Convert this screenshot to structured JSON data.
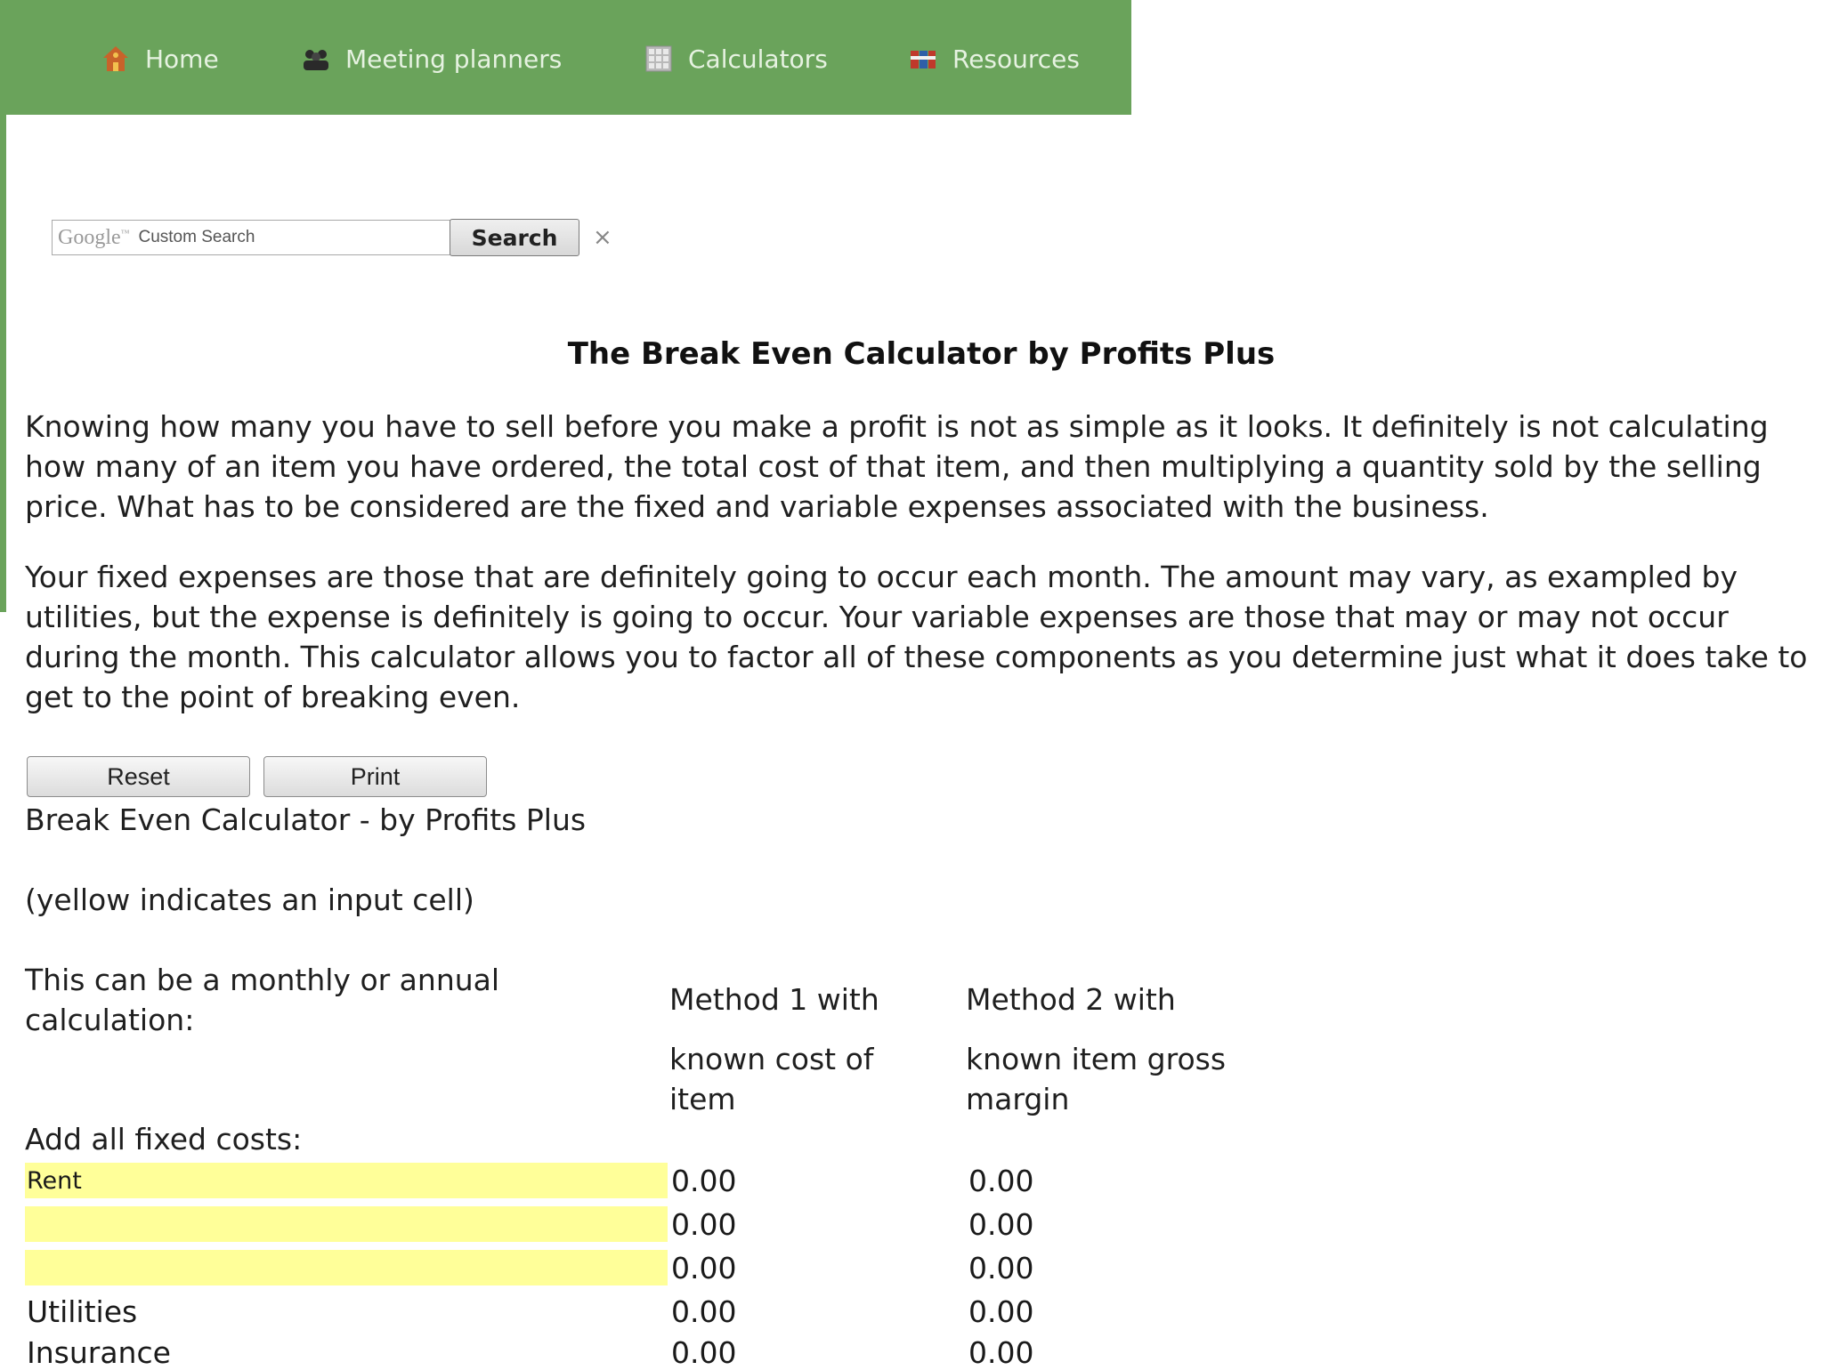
{
  "nav": {
    "items": [
      {
        "label": "Home",
        "icon": "home-icon"
      },
      {
        "label": "Meeting planners",
        "icon": "people-icon"
      },
      {
        "label": "Calculators",
        "icon": "calculator-icon"
      },
      {
        "label": "Resources",
        "icon": "books-icon"
      }
    ]
  },
  "search": {
    "logo_text": "Google",
    "logo_tm": "™",
    "placeholder": "Custom Search",
    "button_label": "Search",
    "clear": "×"
  },
  "page": {
    "title": "The Break Even Calculator by Profits Plus",
    "intro": [
      "Knowing how many you have to sell before you make a profit is not as simple as it looks. It definitely is not calculating how many of an item you have ordered, the total cost of that item, and then multiplying a quantity sold by the selling price. What has to be considered are the fixed and variable expenses associated with the business.",
      "Your fixed expenses are those that are definitely going to occur each month. The amount may vary, as exampled by utilities, but the expense is definitely is going to occur. Your variable expenses are those that may or may not occur during the month. This calculator allows you to factor all of these components as you determine just what it does take to get to the point of breaking even."
    ]
  },
  "calculator": {
    "reset_label": "Reset",
    "print_label": "Print",
    "title": "Break Even Calculator - by Profits Plus",
    "input_note": "(yellow indicates an input cell)",
    "period_note": "This can be a monthly or annual calculation:",
    "method1_head": "Method 1 with",
    "method1_sub": "known cost of item",
    "method2_head": "Method 2 with",
    "method2_sub": "known item gross margin",
    "fixed_label": "Add all fixed costs:",
    "input_color": "#ffff99",
    "rows": [
      {
        "label": "Rent",
        "input": true,
        "m1": "0.00",
        "m2": "0.00"
      },
      {
        "label": "",
        "input": true,
        "m1": "0.00",
        "m2": "0.00"
      },
      {
        "label": "",
        "input": true,
        "m1": "0.00",
        "m2": "0.00"
      },
      {
        "label": "Utilities",
        "input": false,
        "m1": "0.00",
        "m2": "0.00"
      },
      {
        "label": "Insurance",
        "input": false,
        "m1": "0.00",
        "m2": "0.00"
      }
    ]
  },
  "colors": {
    "nav_bg": "#6aa35b",
    "nav_text": "#e6f2e1"
  }
}
